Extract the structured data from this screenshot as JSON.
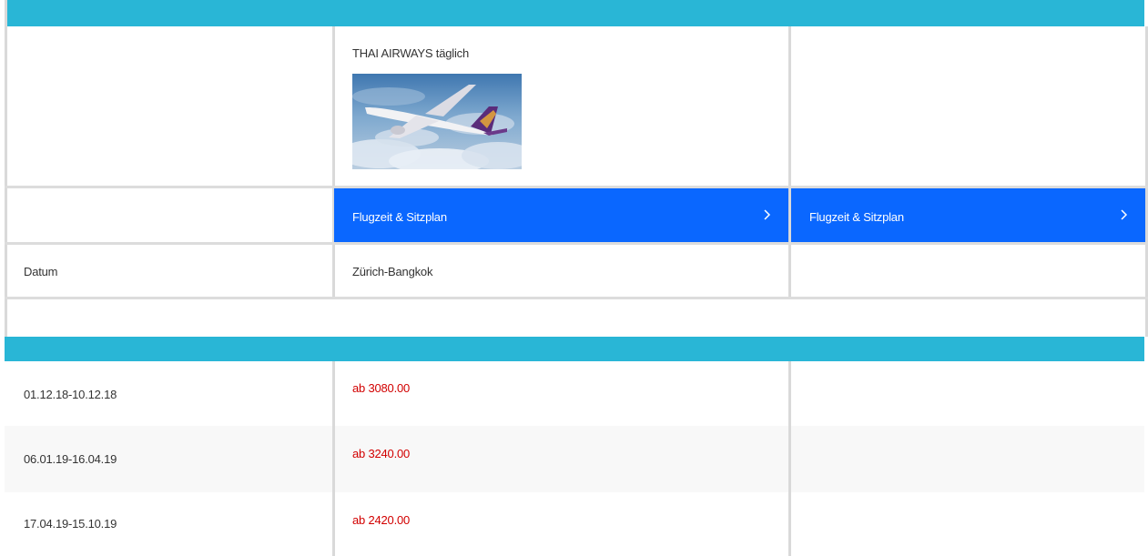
{
  "header": {
    "airline_text": "THAI AIRWAYS täglich",
    "image": "thai-airways-airplane-image"
  },
  "buttons": {
    "flight_info_1": "Flugzeit & Sitzplan",
    "flight_info_2": "Flugzeit & Sitzplan",
    "chevron": "chevron-right-icon"
  },
  "route_row": {
    "date_label": "Datum",
    "route": "Zürich-Bangkok"
  },
  "price_rows": [
    {
      "date": "01.12.18-10.12.18",
      "price": "ab 3080.00"
    },
    {
      "date": "06.01.19-16.04.19",
      "price": "ab 3240.00"
    },
    {
      "date": "17.04.19-15.10.19",
      "price": "ab 2420.00"
    }
  ],
  "colors": {
    "teal_bar": "#29b6d6",
    "button_blue": "#0a67ff",
    "price_red": "#d20000"
  }
}
